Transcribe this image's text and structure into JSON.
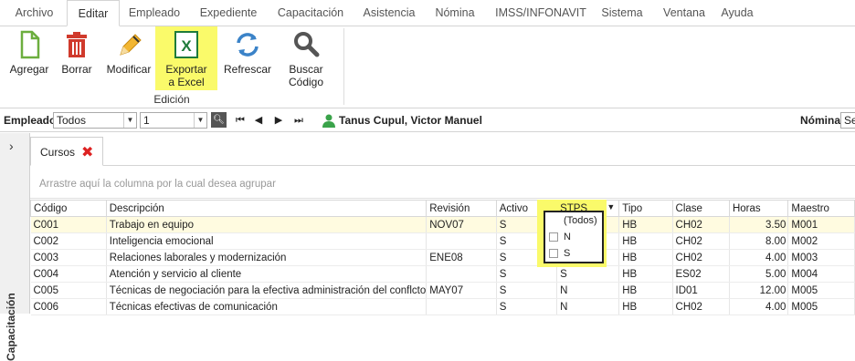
{
  "menu": {
    "tabs": [
      "Archivo",
      "Editar",
      "Empleado",
      "Expediente",
      "Capacitación",
      "Asistencia",
      "Nómina",
      "IMSS/INFONAVIT",
      "Sistema",
      "Ventana",
      "Ayuda"
    ]
  },
  "ribbon": {
    "buttons": [
      {
        "line1": "Agregar",
        "line2": ""
      },
      {
        "line1": "Borrar",
        "line2": ""
      },
      {
        "line1": "Modificar",
        "line2": ""
      },
      {
        "line1": "Exportar",
        "line2": "a Excel"
      },
      {
        "line1": "Refrescar",
        "line2": ""
      },
      {
        "line1": "Buscar",
        "line2": "Código"
      }
    ],
    "group_label": "Edición"
  },
  "nav": {
    "empleado_label": "Empleado:",
    "empleado_value": "Todos",
    "page_value": "1",
    "employee_name": "Tanus Cupul, Victor Manuel",
    "nomina_label": "Nómina:",
    "nomina_value": "Se"
  },
  "side": {
    "label": "Capacitación"
  },
  "doc_tab": {
    "title": "Cursos"
  },
  "group_area_text": "Arrastre aquí la columna por la cual desea agrupar",
  "columns": [
    "Código",
    "Descripción",
    "Revisión",
    "Activo",
    "STPS",
    "Tipo",
    "Clase",
    "Horas",
    "Maestro"
  ],
  "rows": [
    [
      "C001",
      "Trabajo en equipo",
      "NOV07",
      "S",
      "",
      "HB",
      "CH02",
      "3.50",
      "M001"
    ],
    [
      "C002",
      "Inteligencia emocional",
      "",
      "S",
      "",
      "HB",
      "CH02",
      "8.00",
      "M002"
    ],
    [
      "C003",
      "Relaciones laborales y modernización",
      "ENE08",
      "S",
      "",
      "HB",
      "CH02",
      "4.00",
      "M003"
    ],
    [
      "C004",
      "Atención y servicio al cliente",
      "",
      "S",
      "S",
      "HB",
      "ES02",
      "5.00",
      "M004"
    ],
    [
      "C005",
      "Técnicas de negociación para la efectiva administración del conflcto",
      "MAY07",
      "S",
      "N",
      "HB",
      "ID01",
      "12.00",
      "M005"
    ],
    [
      "C006",
      "Técnicas efectivas de comunicación",
      "",
      "S",
      "N",
      "HB",
      "CH02",
      "4.00",
      "M005"
    ]
  ],
  "filter_popup": {
    "options": [
      "(Todos)",
      "N",
      "S"
    ]
  }
}
